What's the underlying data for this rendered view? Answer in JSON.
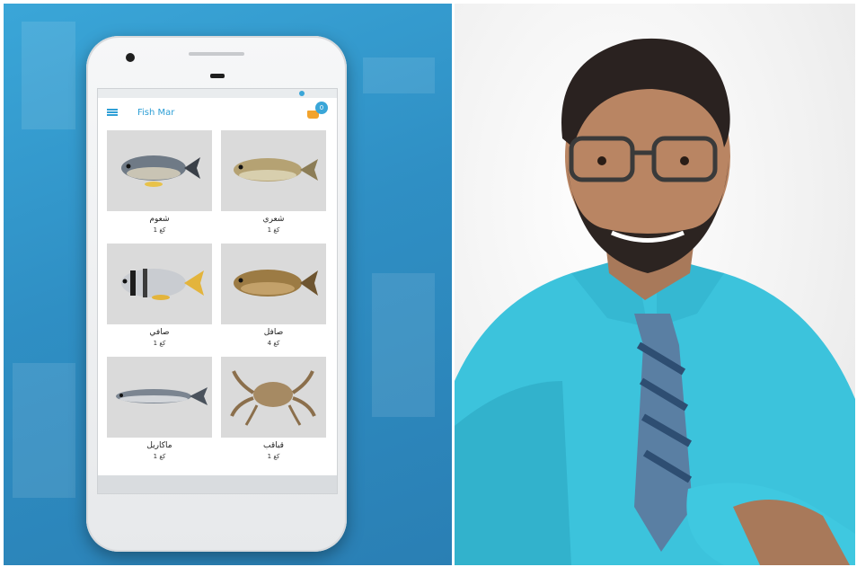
{
  "app": {
    "title": "Fish Mar",
    "cart_count": "0"
  },
  "products": [
    {
      "name": "شعوم",
      "price": "1 كغ"
    },
    {
      "name": "شعري",
      "price": "1 كغ"
    },
    {
      "name": "صافي",
      "price": "1 كغ"
    },
    {
      "name": "صافل",
      "price": "4 كغ"
    },
    {
      "name": "ماكاريل",
      "price": "1 كغ"
    },
    {
      "name": "قباقب",
      "price": "1 كغ"
    }
  ],
  "colors": {
    "brand": "#2f9fd6",
    "cart_icon": "#f2a32d",
    "card_background": "#dadada",
    "shirt": "#3cc3dc"
  },
  "icons": [
    "menu-icon",
    "cart-icon"
  ]
}
